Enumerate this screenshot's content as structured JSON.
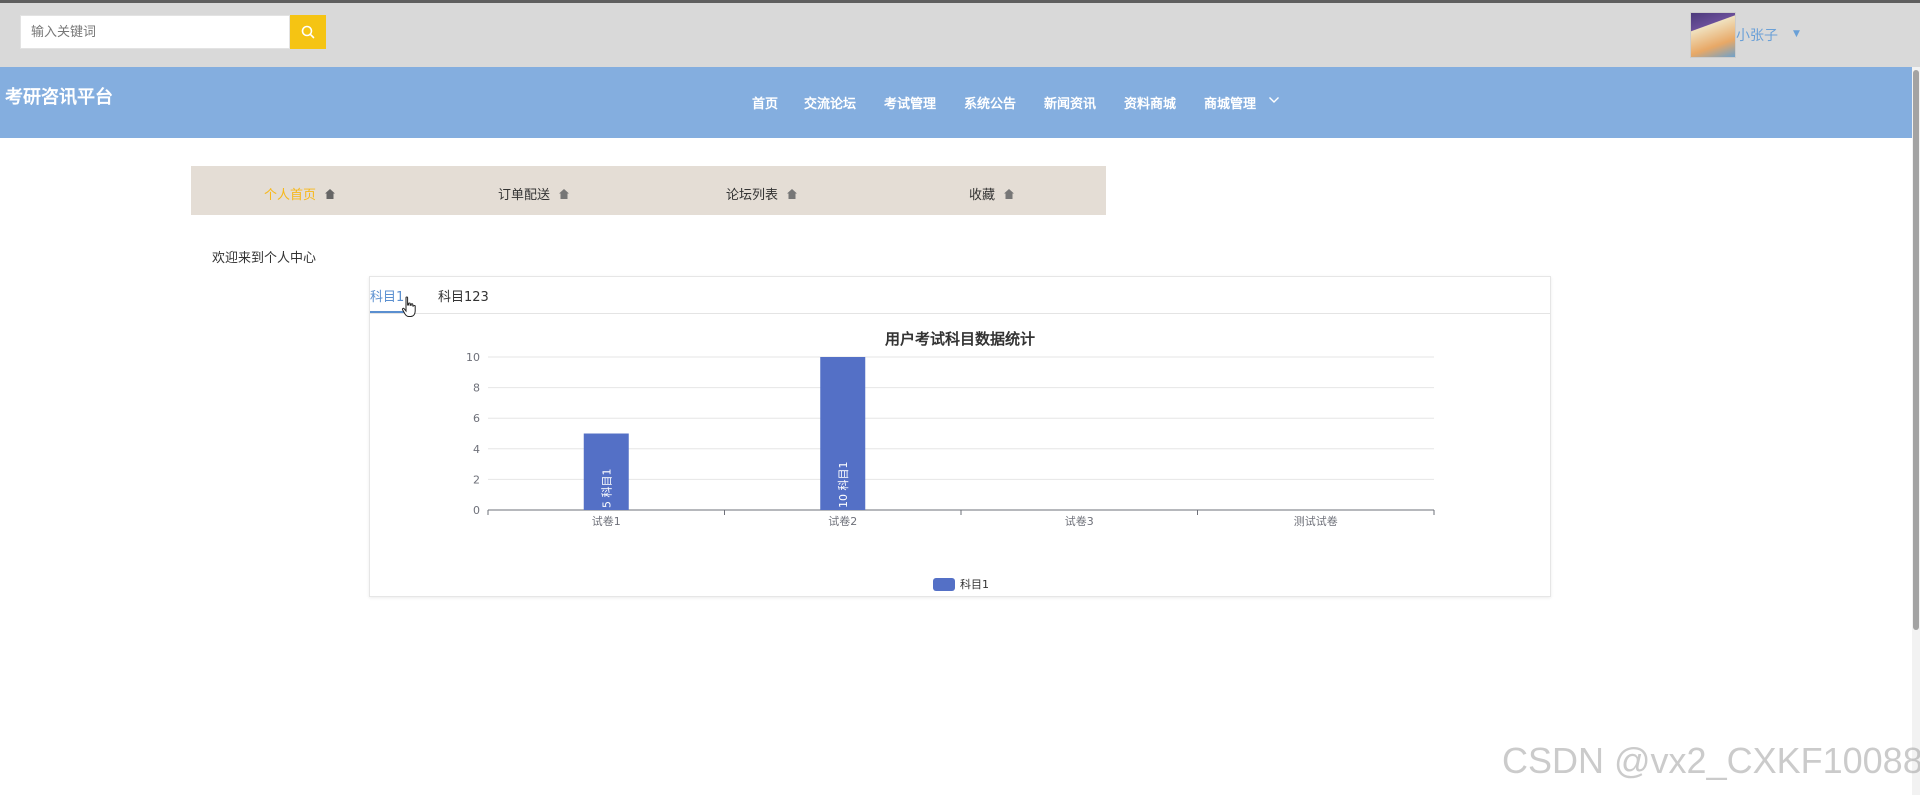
{
  "search": {
    "placeholder": "输入关键词"
  },
  "user": {
    "name": "小张子"
  },
  "brand": {
    "title": "考研咨讯平台"
  },
  "nav": {
    "items": [
      "首页",
      "交流论坛",
      "考试管理",
      "系统公告",
      "新闻资讯",
      "资料商城",
      "商城管理"
    ]
  },
  "user_nav": {
    "items": [
      "个人首页",
      "订单配送",
      "论坛列表",
      "收藏"
    ]
  },
  "welcome": "欢迎来到个人中心",
  "tabs": [
    "科目1",
    "科目123"
  ],
  "chart_data": {
    "type": "bar",
    "title": "用户考试科目数据统计",
    "categories": [
      "试卷1",
      "试卷2",
      "试卷3",
      "测试试卷"
    ],
    "series": [
      {
        "name": "科目1",
        "values": [
          5,
          10,
          0,
          0
        ],
        "color": "#5470c6"
      }
    ],
    "ylim": [
      0,
      10
    ],
    "yticks": [
      0,
      2,
      4,
      6,
      8,
      10
    ],
    "grid": true,
    "legend": "bottom-center",
    "data_labels": [
      "5 科目1",
      "10 科目1",
      "",
      ""
    ]
  },
  "watermark": "CSDN @vx2_CXKF10088",
  "colors": {
    "navbar": "#84aedf",
    "accent": "#f5c413",
    "active_tab": "#5a8fd0",
    "usernav_active": "#f7b81a",
    "bar": "#5470c6"
  }
}
